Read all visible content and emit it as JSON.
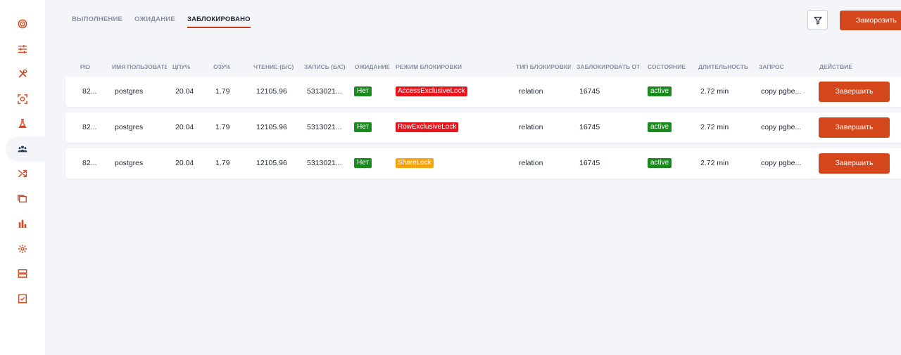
{
  "colors": {
    "accent": "#d4461c",
    "green": "#1a8a1f",
    "red": "#e8141b",
    "yellow": "#f5a40f"
  },
  "sidebar": {
    "items": [
      {
        "icon": "target-icon"
      },
      {
        "icon": "sliders-icon"
      },
      {
        "icon": "tools-icon"
      },
      {
        "icon": "scan-icon"
      },
      {
        "icon": "flask-icon"
      },
      {
        "icon": "users-icon",
        "active": true
      },
      {
        "icon": "shuffle-icon"
      },
      {
        "icon": "folder-icon"
      },
      {
        "icon": "bar-chart-icon"
      },
      {
        "icon": "gear-icon"
      },
      {
        "icon": "server-icon"
      },
      {
        "icon": "checklist-icon"
      }
    ]
  },
  "tabs": [
    {
      "label": "ВЫПОЛНЕНИЕ",
      "active": false
    },
    {
      "label": "ОЖИДАНИЕ",
      "active": false
    },
    {
      "label": "ЗАБЛОКИРОВАНО",
      "active": true
    }
  ],
  "toolbar": {
    "filter_icon": "filter-icon",
    "freeze_label": "Заморозить"
  },
  "table": {
    "columns": [
      "PID",
      "ИМЯ ПОЛЬЗОВАТЕ",
      "ЦПУ%",
      "ОЗУ%",
      "ЧТЕНИЕ (Б/С)",
      "ЗАПИСЬ (Б/С)",
      "ОЖИДАНИЕ",
      "РЕЖИМ БЛОКИРОВКИ",
      "ТИП БЛОКИРОВКИ",
      "ЗАБЛОКИРОВАТЬ ОТ",
      "СОСТОЯНИЕ",
      "ДЛИТЕЛЬНОСТЬ",
      "ЗАПРОС",
      "ДЕЙСТВИЕ"
    ],
    "rows": [
      {
        "pid": "82...",
        "user": "postgres",
        "cpu": "20.04",
        "ram": "1.79",
        "read": "12105.96",
        "write": "5313021...",
        "wait": "Нет",
        "lock_mode": "AccessExclusiveLock",
        "lock_color": "red",
        "lock_type": "relation",
        "blocked_by": "16745",
        "state": "active",
        "duration": "2.72 min",
        "query": "copy pgbe...",
        "action": "Завершить"
      },
      {
        "pid": "82...",
        "user": "postgres",
        "cpu": "20.04",
        "ram": "1.79",
        "read": "12105.96",
        "write": "5313021...",
        "wait": "Нет",
        "lock_mode": "RowExclusiveLock",
        "lock_color": "red",
        "lock_type": "relation",
        "blocked_by": "16745",
        "state": "active",
        "duration": "2.72 min",
        "query": "copy pgbe...",
        "action": "Завершить"
      },
      {
        "pid": "82...",
        "user": "postgres",
        "cpu": "20.04",
        "ram": "1.79",
        "read": "12105.96",
        "write": "5313021...",
        "wait": "Нет",
        "lock_mode": "ShareLock",
        "lock_color": "yellow",
        "lock_type": "relation",
        "blocked_by": "16745",
        "state": "active",
        "duration": "2.72 min",
        "query": "copy pgbe...",
        "action": "Завершить"
      }
    ]
  }
}
